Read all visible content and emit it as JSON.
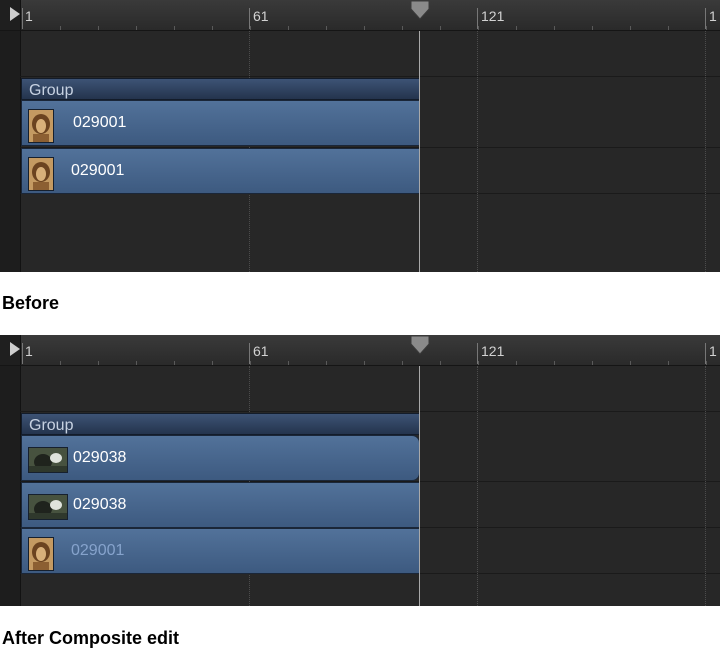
{
  "ruler": {
    "marks": [
      "1",
      "61",
      "121",
      "1"
    ]
  },
  "before": {
    "group_label": "Group",
    "clips": [
      {
        "label": "029001",
        "thumb": "lion-thumbnail-icon"
      },
      {
        "label": "029001",
        "thumb": "lion-thumbnail-icon"
      }
    ],
    "caption": "Before"
  },
  "after": {
    "group_label": "Group",
    "clips": [
      {
        "label": "029038",
        "thumb": "gorilla-thumbnail-icon"
      },
      {
        "label": "029038",
        "thumb": "gorilla-thumbnail-icon"
      },
      {
        "label": "029001",
        "thumb": "lion-thumbnail-icon"
      }
    ],
    "caption": "After Composite edit"
  },
  "colors": {
    "track_background": "#272727",
    "clip_blue": "#4b6891",
    "group_bar": "#2f425f",
    "dimmed_label": "#86a3cc"
  }
}
